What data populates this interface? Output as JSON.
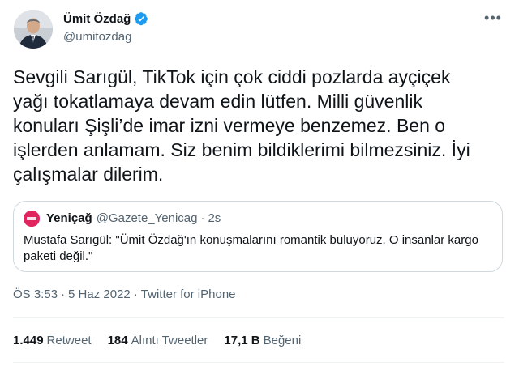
{
  "author": {
    "name": "Ümit Özdağ",
    "handle": "@umitozdag",
    "verified": true
  },
  "more_icon": "more-horizontal-icon",
  "tweet_text": "Sevgili Sarıgül, TikTok için çok ciddi pozlarda ayçiçek\nyağı tokatlamaya devam edin lütfen. Milli güvenlik\nkonuları Şişli’de imar izni vermeye benzemez. Ben o\nişlerden anlamam. Siz benim bildiklerimi bilmezsiniz. İyi\nçalışmalar dilerim.",
  "quote": {
    "name": "Yeniçağ",
    "handle": "@Gazete_Yenicag",
    "separator": "·",
    "time": "2s",
    "text": "Mustafa Sarıgül: \"Ümit Özdağ'ın konuşmalarını romantik buluyoruz. O insanlar kargo paketi değil.\""
  },
  "meta": {
    "time": "ÖS 3:53",
    "separator": "·",
    "date": "5 Haz 2022",
    "source": "Twitter for iPhone"
  },
  "stats": {
    "retweets": {
      "count": "1.449",
      "label": "Retweet"
    },
    "quotes": {
      "count": "184",
      "label": "Alıntı Tweetler"
    },
    "likes": {
      "count": "17,1 B",
      "label": "Beğeni"
    }
  },
  "colors": {
    "verified": "#1d9bf0",
    "secondary_text": "#536471",
    "border": "#cfd9de"
  }
}
